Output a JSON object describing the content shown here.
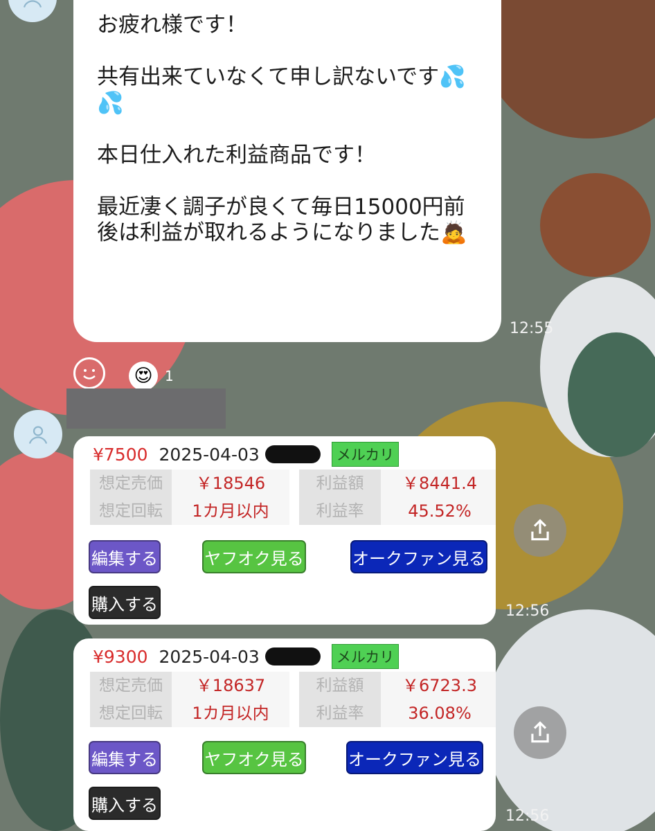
{
  "message": {
    "paragraphs": [
      "お疲れ様です！",
      "共有出来ていなくて申し訳ないです💦💦",
      "本日仕入れた利益商品です！",
      "最近凄く調子が良くて毎日15000円前後は利益が取れるようになりました🙇"
    ],
    "time": "12:55"
  },
  "reaction": {
    "emoji": "😍",
    "count": "1"
  },
  "cards": [
    {
      "price": "¥7500",
      "date": "2025-04-03",
      "platform": "メルカリ",
      "rows": [
        {
          "k1": "想定売価",
          "v1": "￥18546",
          "k2": "利益額",
          "v2": "￥8441.4"
        },
        {
          "k1": "想定回転",
          "v1": "1カ月以内",
          "k2": "利益率",
          "v2": "45.52%"
        }
      ],
      "buttons": {
        "edit": "編集する",
        "yahoo": "ヤフオク見る",
        "aucfan": "オークファン見る",
        "buy": "購入する"
      },
      "time": "12:56"
    },
    {
      "price": "¥9300",
      "date": "2025-04-03",
      "platform": "メルカリ",
      "rows": [
        {
          "k1": "想定売価",
          "v1": "￥18637",
          "k2": "利益額",
          "v2": "￥6723.3"
        },
        {
          "k1": "想定回転",
          "v1": "1カ月以内",
          "k2": "利益率",
          "v2": "36.08%"
        }
      ],
      "buttons": {
        "edit": "編集する",
        "yahoo": "ヤフオク見る",
        "aucfan": "オークファン見る",
        "buy": "購入する"
      },
      "time": "12:56"
    }
  ],
  "colors": {
    "price_red": "#d82b2b",
    "mercari_green": "#4fd054",
    "edit_purple": "#6c57c7",
    "yahoo_green": "#57c442",
    "aucfan_blue": "#0b27b8"
  },
  "icons": [
    "user-avatar-icon",
    "smiley-icon",
    "share-icon"
  ]
}
